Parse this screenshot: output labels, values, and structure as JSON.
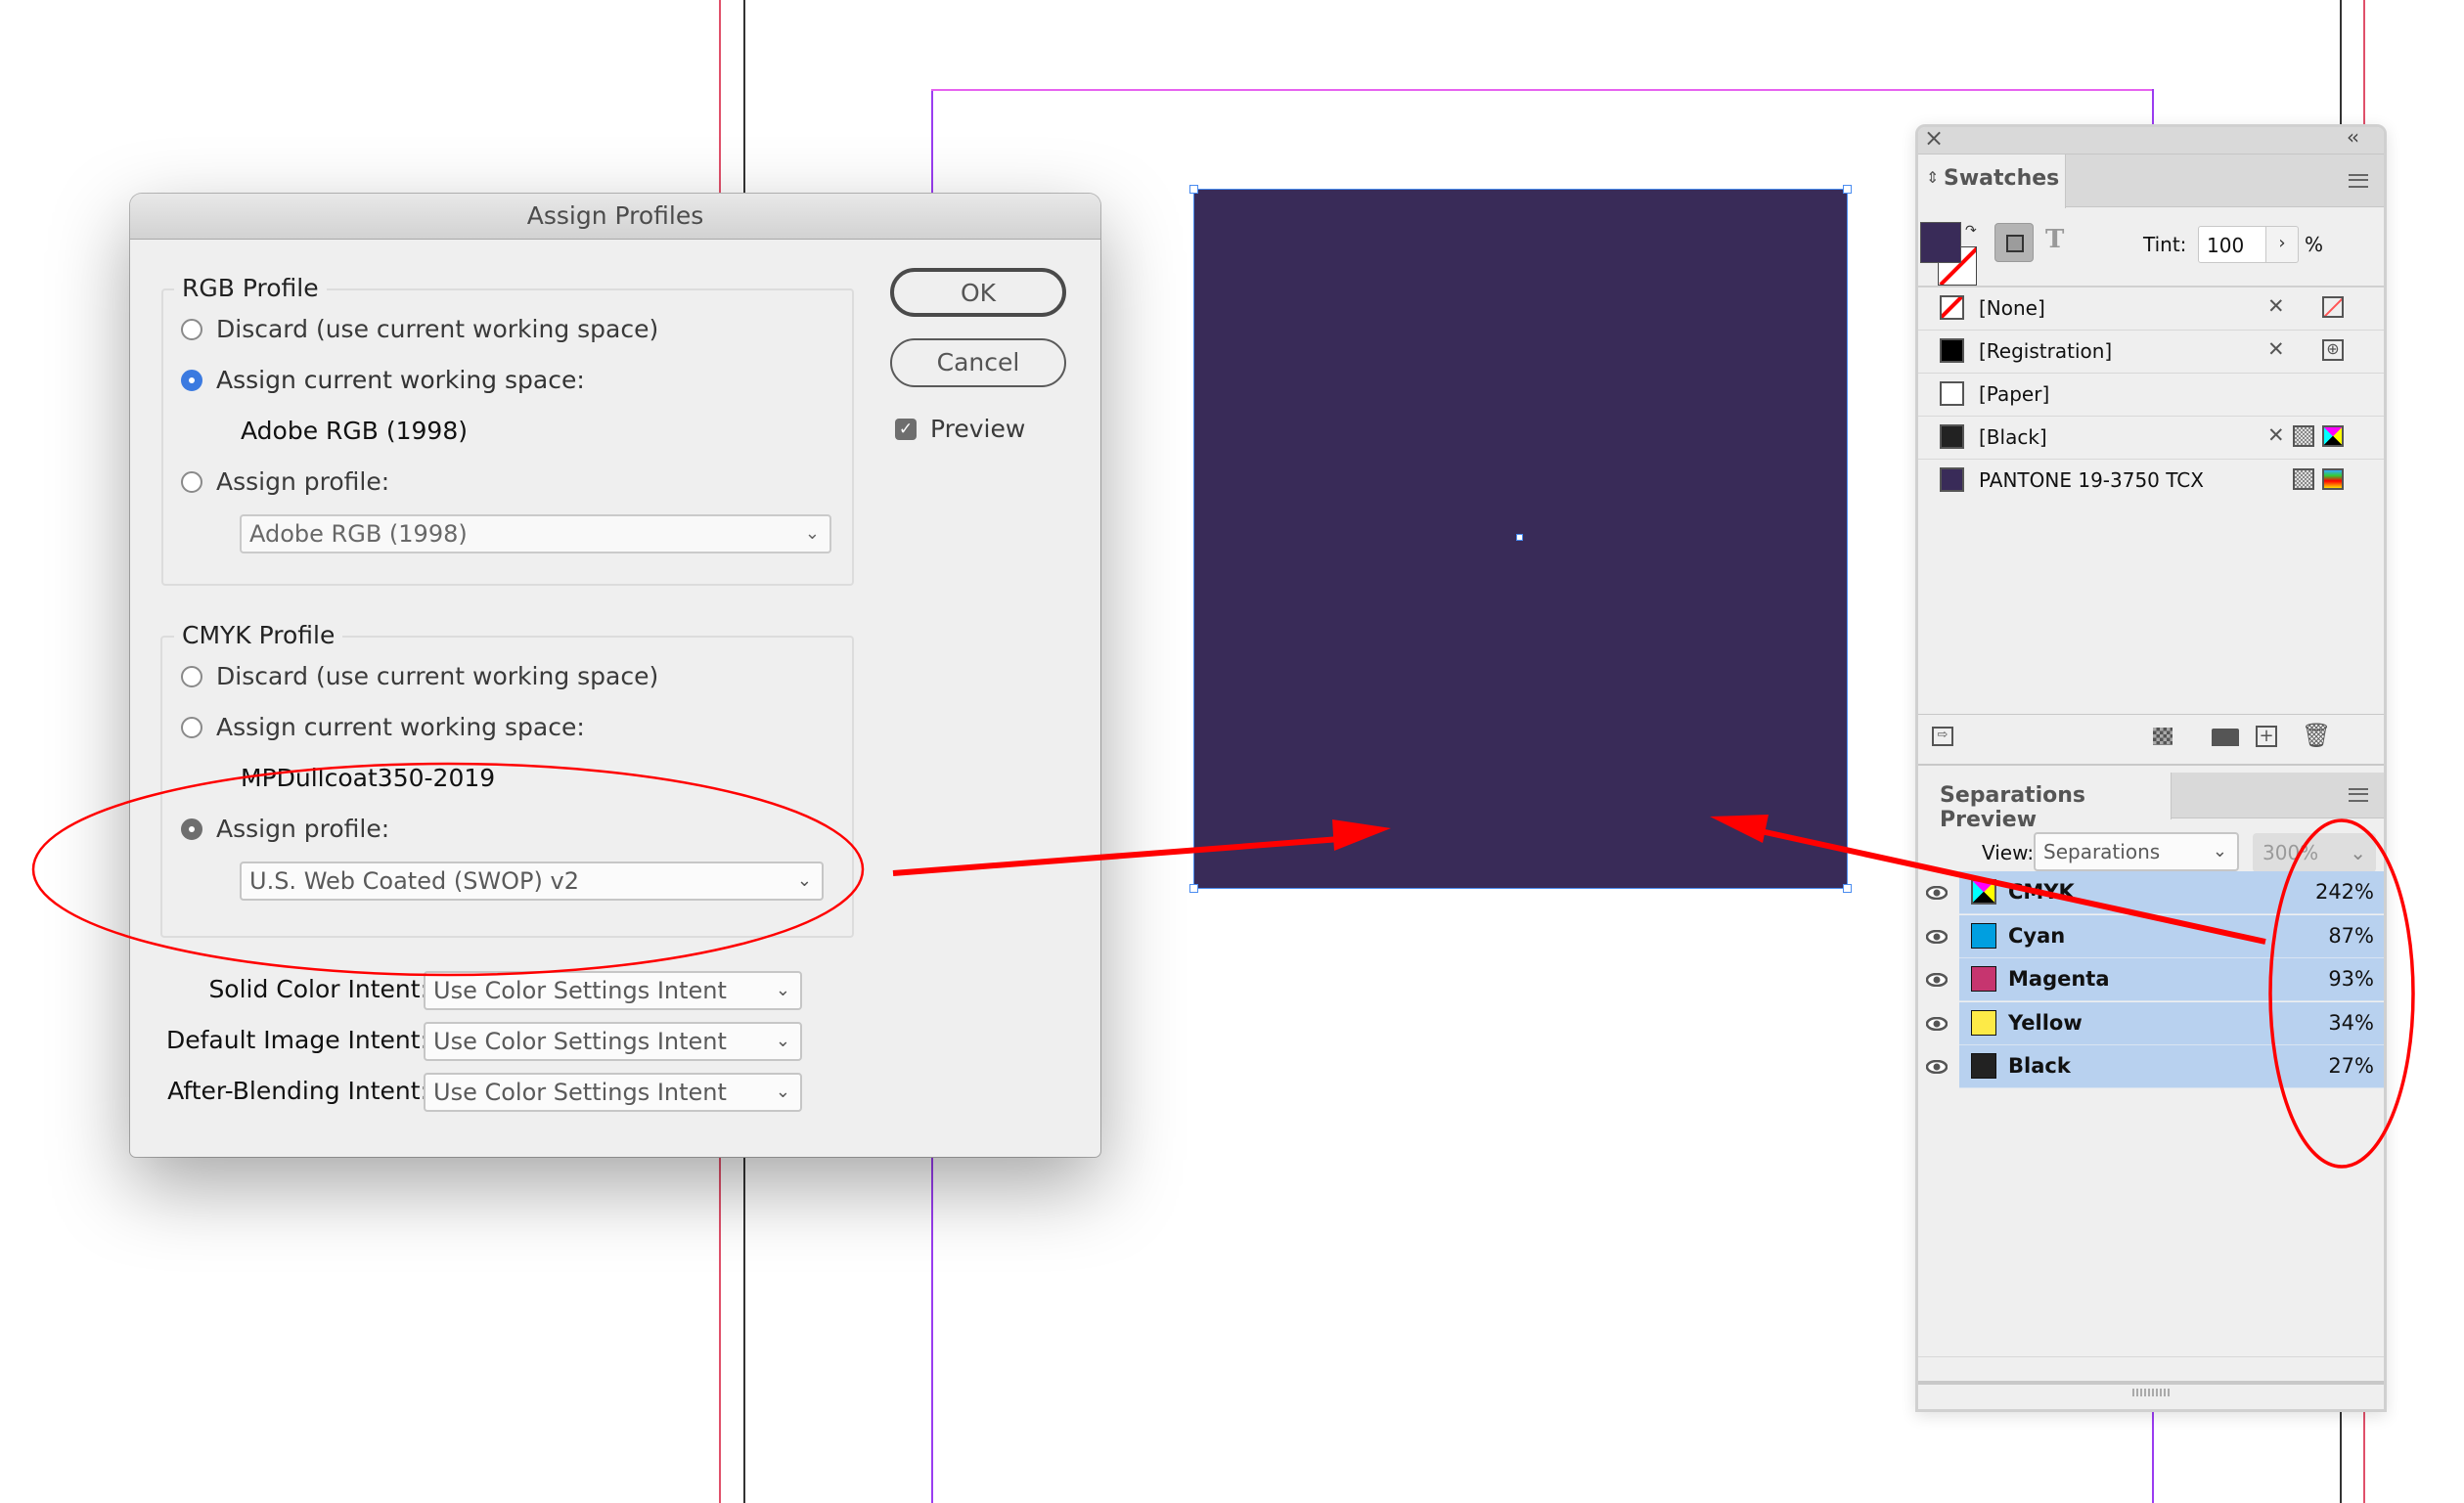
{
  "dialog": {
    "title": "Assign Profiles",
    "rgb_group": {
      "label": "RGB Profile",
      "options": [
        {
          "label": "Discard (use current working space)",
          "selected": false
        },
        {
          "label": "Assign current working space:",
          "selected": true
        },
        {
          "label": "Assign profile:",
          "selected": false
        }
      ],
      "working_space": "Adobe RGB (1998)",
      "profile_select": "Adobe RGB (1998)"
    },
    "cmyk_group": {
      "label": "CMYK Profile",
      "options": [
        {
          "label": "Discard (use current working space)",
          "selected": false
        },
        {
          "label": "Assign current working space:",
          "selected": false
        },
        {
          "label": "Assign profile:",
          "selected": true
        }
      ],
      "working_space": "MPDullcoat350-2019",
      "profile_select": "U.S. Web Coated (SWOP) v2"
    },
    "intents": [
      {
        "label": "Solid Color Intent:",
        "value": "Use Color Settings Intent"
      },
      {
        "label": "Default Image Intent:",
        "value": "Use Color Settings Intent"
      },
      {
        "label": "After-Blending Intent:",
        "value": "Use Color Settings Intent"
      }
    ],
    "ok_label": "OK",
    "cancel_label": "Cancel",
    "preview_label": "Preview",
    "preview_checked": true
  },
  "canvas": {
    "frame_fill": "#392b58"
  },
  "swatches_panel": {
    "close_icon": "×",
    "collapse_icon": "‹‹",
    "tab_label": "Swatches",
    "tint_label": "Tint:",
    "tint_value": "100",
    "tint_unit": "%",
    "items": [
      {
        "name": "[None]",
        "chip": "none"
      },
      {
        "name": "[Registration]",
        "chip": "#000000"
      },
      {
        "name": "[Paper]",
        "chip": "#ffffff"
      },
      {
        "name": "[Black]",
        "chip": "#222222"
      },
      {
        "name": "PANTONE 19-3750 TCX",
        "chip": "#392b58"
      }
    ]
  },
  "separations_panel": {
    "tab_label": "Separations Preview",
    "view_label": "View:",
    "view_value": "Separations",
    "ink_limit_value": "300%",
    "rows": [
      {
        "name": "CMYK",
        "value": "242%",
        "color": "cmyk"
      },
      {
        "name": "Cyan",
        "value": "87%",
        "color": "#009fe0"
      },
      {
        "name": "Magenta",
        "value": "93%",
        "color": "#c6356f"
      },
      {
        "name": "Yellow",
        "value": "34%",
        "color": "#fdea47"
      },
      {
        "name": "Black",
        "value": "27%",
        "color": "#222222"
      }
    ]
  },
  "annotations": {
    "color": "#ff0000"
  }
}
